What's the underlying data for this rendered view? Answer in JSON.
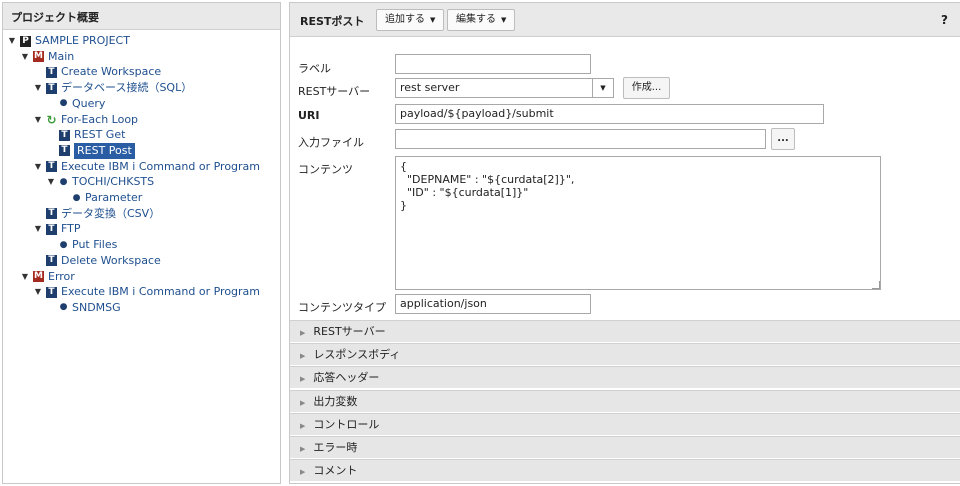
{
  "left": {
    "header": "プロジェクト概要",
    "tree": [
      {
        "label": "SAMPLE PROJECT",
        "icon": "project-icon",
        "type": "p",
        "toggle": "▼",
        "depth": 0
      },
      {
        "label": "Main",
        "icon": "module-icon",
        "type": "m",
        "toggle": "▼",
        "depth": 1
      },
      {
        "label": "Create Workspace",
        "icon": "task-icon",
        "type": "t",
        "toggle": "",
        "depth": 2
      },
      {
        "label": "データベース接続（SQL）",
        "icon": "task-icon",
        "type": "t",
        "toggle": "▼",
        "depth": 2
      },
      {
        "label": "Query",
        "icon": "bullet-icon",
        "type": "dot",
        "toggle": "",
        "depth": 3
      },
      {
        "label": "For-Each Loop",
        "icon": "loop-icon",
        "type": "loop",
        "toggle": "▼",
        "depth": 2
      },
      {
        "label": "REST Get",
        "icon": "task-icon",
        "type": "t",
        "toggle": "",
        "depth": 3
      },
      {
        "label": "REST Post",
        "icon": "task-icon",
        "type": "t",
        "toggle": "",
        "depth": 3,
        "selected": true
      },
      {
        "label": "Execute IBM i Command or Program",
        "icon": "task-icon",
        "type": "t",
        "toggle": "▼",
        "depth": 2
      },
      {
        "label": "TOCHI/CHKSTS",
        "icon": "bullet-icon",
        "type": "dot",
        "toggle": "▼",
        "depth": 3
      },
      {
        "label": "Parameter",
        "icon": "bullet-icon",
        "type": "dot",
        "toggle": "",
        "depth": 4
      },
      {
        "label": "データ変換（CSV）",
        "icon": "task-icon",
        "type": "t",
        "toggle": "",
        "depth": 2
      },
      {
        "label": "FTP",
        "icon": "task-icon",
        "type": "t",
        "toggle": "▼",
        "depth": 2
      },
      {
        "label": "Put Files",
        "icon": "bullet-icon",
        "type": "dot",
        "toggle": "",
        "depth": 3
      },
      {
        "label": "Delete Workspace",
        "icon": "task-icon",
        "type": "t",
        "toggle": "",
        "depth": 2
      },
      {
        "label": "Error",
        "icon": "module-icon",
        "type": "m",
        "toggle": "▼",
        "depth": 1
      },
      {
        "label": "Execute IBM i Command or Program",
        "icon": "task-icon",
        "type": "t",
        "toggle": "▼",
        "depth": 2
      },
      {
        "label": "SNDMSG",
        "icon": "bullet-icon",
        "type": "dot",
        "toggle": "",
        "depth": 3
      }
    ]
  },
  "toolbar": {
    "title": "RESTポスト",
    "add_label": "追加する",
    "edit_label": "編集する",
    "help": "?"
  },
  "form": {
    "label_label": "ラベル",
    "label_value": "",
    "server_label": "RESTサーバー",
    "server_value": "rest server",
    "create_label": "作成...",
    "uri_label": "URI",
    "uri_value": "payload/${payload}/submit",
    "input_file_label": "入力ファイル",
    "input_file_value": "",
    "browse_label": "...",
    "content_label": "コンテンツ",
    "content_value": "{\n  \"DEPNAME\" : \"${curdata[2]}\",\n  \"ID\" : \"${curdata[1]}\"\n}",
    "content_type_label": "コンテンツタイプ",
    "content_type_value": "application/json"
  },
  "sections": [
    "RESTサーバー",
    "レスポンスボディ",
    "応答ヘッダー",
    "出力変数",
    "コントロール",
    "エラー時",
    "コメント"
  ],
  "colors": {
    "link": "#1f4f8f",
    "selected": "#2b5da4",
    "module_icon": "#a42a1f",
    "task_icon": "#1e3f6d"
  }
}
